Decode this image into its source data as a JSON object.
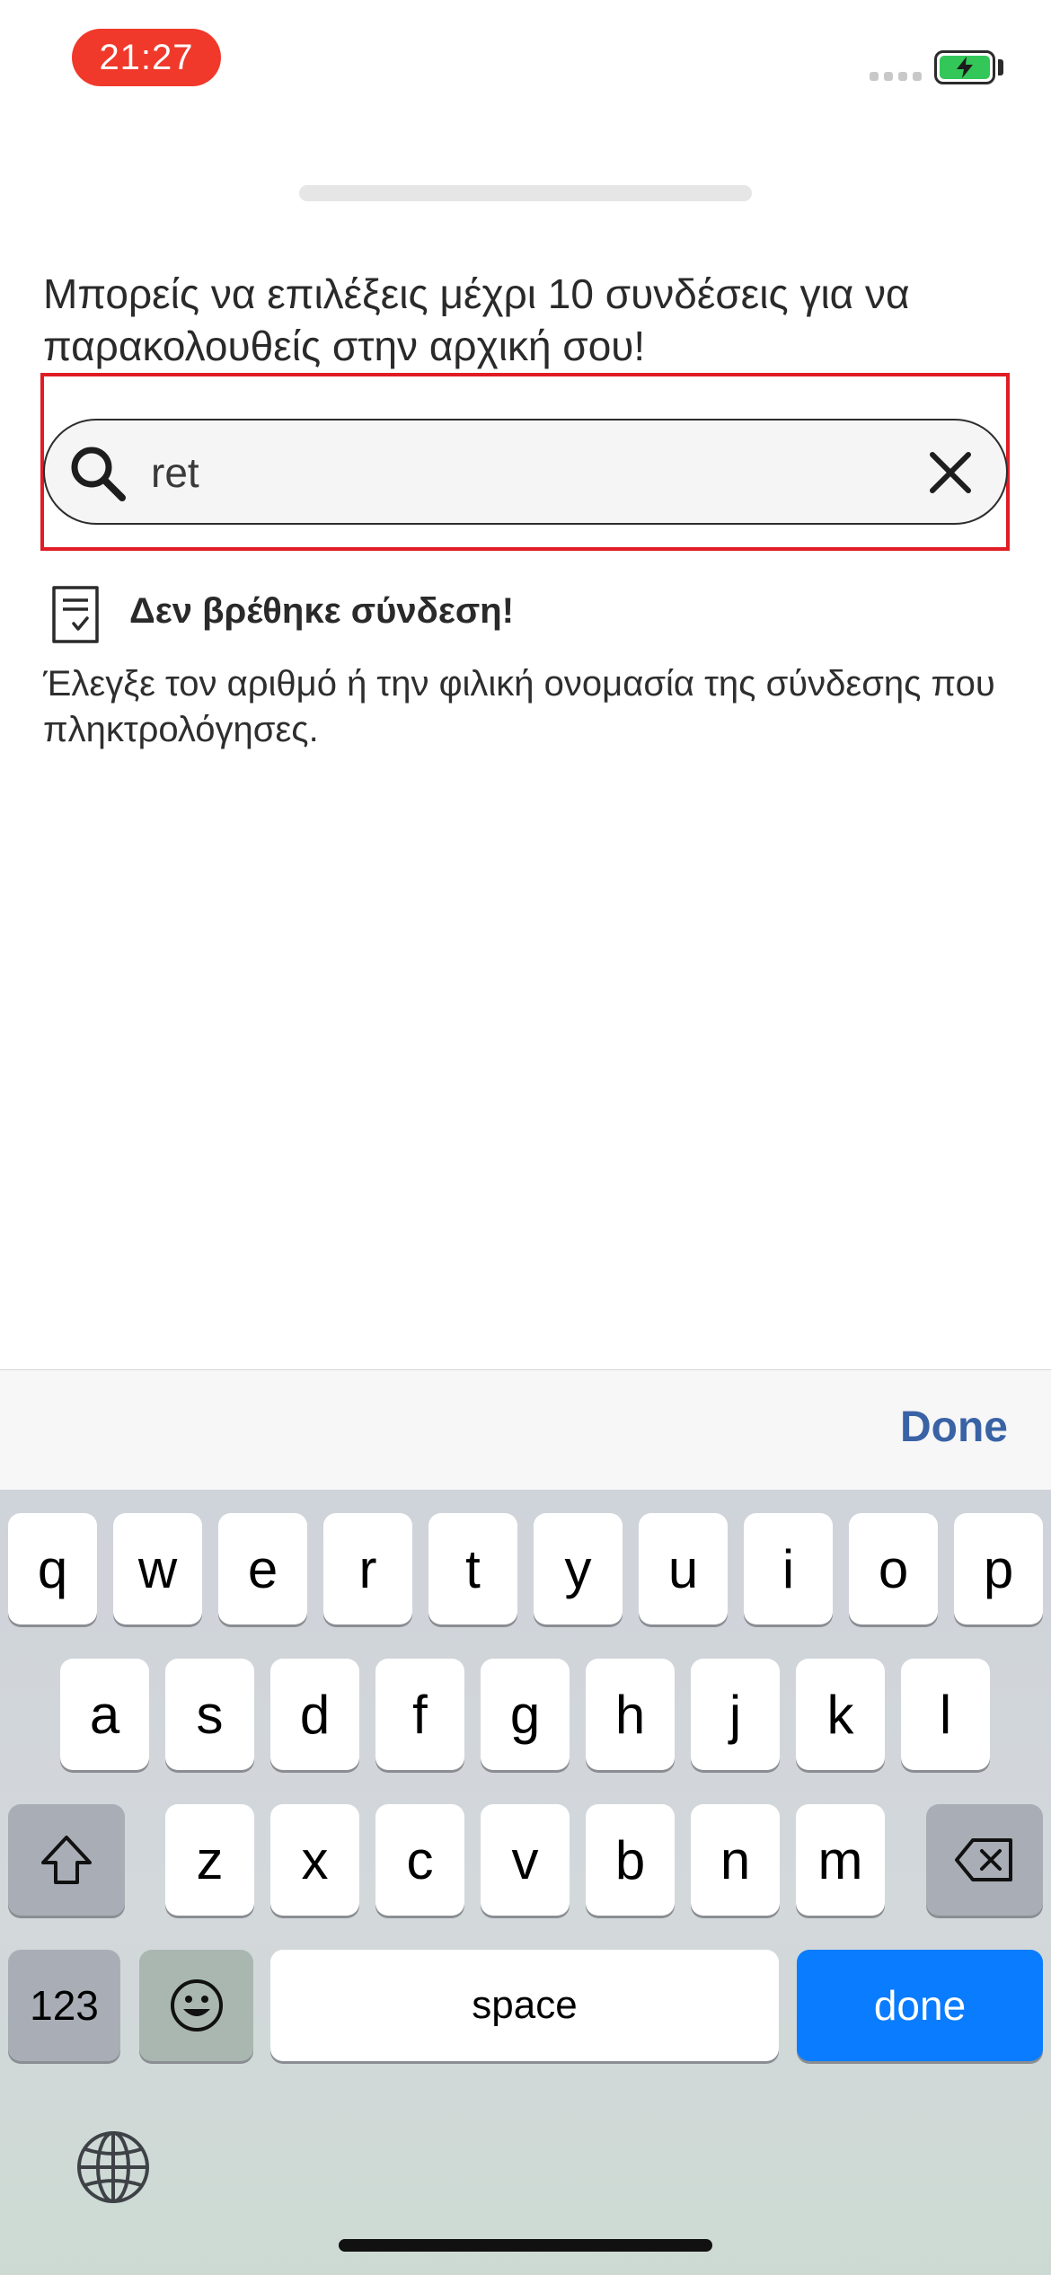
{
  "status_bar": {
    "time": "21:27",
    "battery_color": "#33c759",
    "time_pill_color": "#f0392b"
  },
  "intro": {
    "text": "Μπορείς να επιλέξεις μέχρι 10 συνδέσεις για να παρακολουθείς στην αρχική σου!"
  },
  "search": {
    "value": "ret",
    "icon": "search-icon",
    "clear_icon": "close-icon",
    "highlight_color": "#e01d24"
  },
  "empty_state": {
    "icon": "document-check-icon",
    "title": "Δεν βρέθηκε σύνδεση!",
    "description": "Έλεγξε τον αριθμό ή την φιλική ονομασία της σύνδεσης που πληκτρολόγησες."
  },
  "accessory_bar": {
    "done_label": "Done",
    "done_color": "#3a63a6"
  },
  "keyboard": {
    "row1": [
      "q",
      "w",
      "e",
      "r",
      "t",
      "y",
      "u",
      "i",
      "o",
      "p"
    ],
    "row2": [
      "a",
      "s",
      "d",
      "f",
      "g",
      "h",
      "j",
      "k",
      "l"
    ],
    "row3": [
      "z",
      "x",
      "c",
      "v",
      "b",
      "n",
      "m"
    ],
    "shift_icon": "shift-icon",
    "backspace_icon": "backspace-icon",
    "numbers_label": "123",
    "emoji_icon": "emoji-icon",
    "space_label": "space",
    "done_label": "done",
    "done_color": "#0a7cff",
    "globe_icon": "globe-icon"
  }
}
